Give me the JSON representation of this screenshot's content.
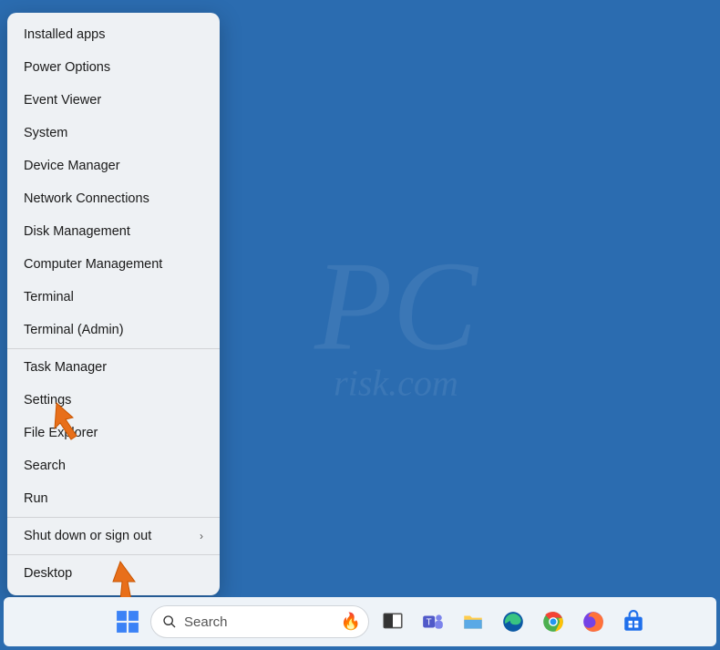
{
  "watermark": {
    "line1": "PC",
    "line2": "risk.com"
  },
  "menu": {
    "groups": [
      [
        {
          "label": "Installed apps"
        },
        {
          "label": "Power Options"
        },
        {
          "label": "Event Viewer"
        },
        {
          "label": "System"
        },
        {
          "label": "Device Manager"
        },
        {
          "label": "Network Connections"
        },
        {
          "label": "Disk Management"
        },
        {
          "label": "Computer Management"
        },
        {
          "label": "Terminal"
        },
        {
          "label": "Terminal (Admin)"
        }
      ],
      [
        {
          "label": "Task Manager"
        },
        {
          "label": "Settings"
        },
        {
          "label": "File Explorer"
        },
        {
          "label": "Search"
        },
        {
          "label": "Run"
        }
      ],
      [
        {
          "label": "Shut down or sign out",
          "submenu": true
        }
      ],
      [
        {
          "label": "Desktop"
        }
      ]
    ]
  },
  "taskbar": {
    "search_placeholder": "Search",
    "icons": [
      {
        "name": "task-view-icon"
      },
      {
        "name": "teams-icon"
      },
      {
        "name": "file-explorer-icon"
      },
      {
        "name": "edge-icon"
      },
      {
        "name": "chrome-icon"
      },
      {
        "name": "firefox-icon"
      },
      {
        "name": "store-icon"
      }
    ]
  }
}
